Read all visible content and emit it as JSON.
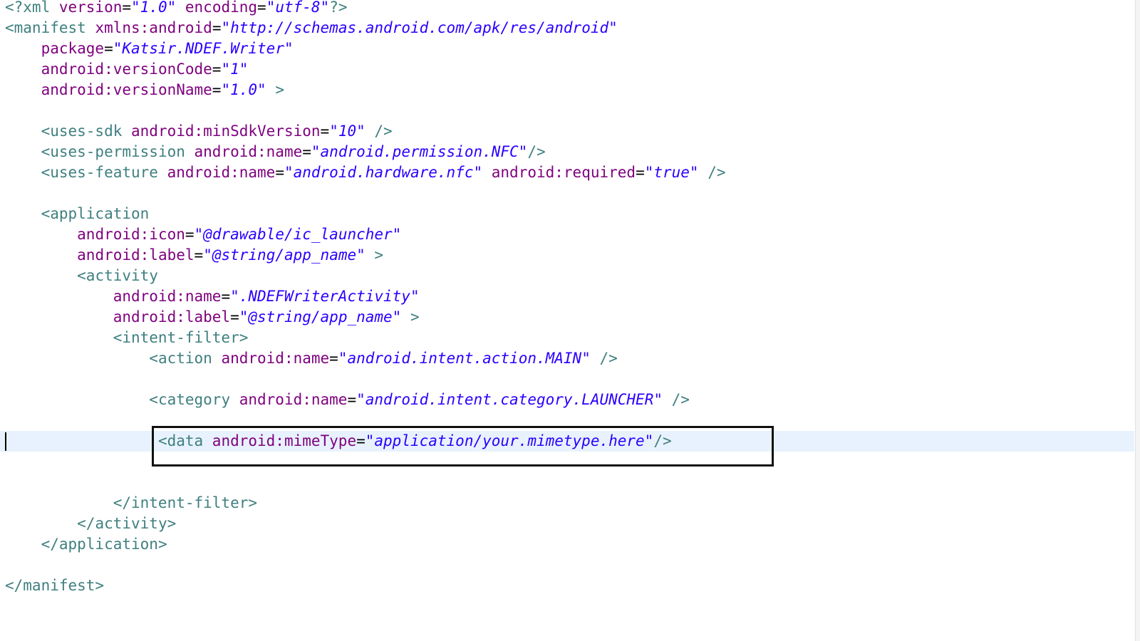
{
  "editor": {
    "lines": [
      [
        {
          "t": "<?xml ",
          "c": "tag"
        },
        {
          "t": "version",
          "c": "attr"
        },
        {
          "t": "=",
          "c": "eq"
        },
        {
          "t": "\"1.0\"",
          "c": "val"
        },
        {
          "t": " encoding",
          "c": "attr"
        },
        {
          "t": "=",
          "c": "eq"
        },
        {
          "t": "\"utf-8\"",
          "c": "val"
        },
        {
          "t": "?>",
          "c": "tag"
        }
      ],
      [
        {
          "t": "<manifest ",
          "c": "tag"
        },
        {
          "t": "xmlns:android",
          "c": "attr"
        },
        {
          "t": "=",
          "c": "eq"
        },
        {
          "t": "\"http://schemas.android.com/apk/res/android\"",
          "c": "val"
        }
      ],
      [
        {
          "t": "    "
        },
        {
          "t": "package",
          "c": "attr"
        },
        {
          "t": "=",
          "c": "eq"
        },
        {
          "t": "\"Katsir.NDEF.Writer\"",
          "c": "val"
        }
      ],
      [
        {
          "t": "    "
        },
        {
          "t": "android:versionCode",
          "c": "attr"
        },
        {
          "t": "=",
          "c": "eq"
        },
        {
          "t": "\"1\"",
          "c": "val"
        }
      ],
      [
        {
          "t": "    "
        },
        {
          "t": "android:versionName",
          "c": "attr"
        },
        {
          "t": "=",
          "c": "eq"
        },
        {
          "t": "\"1.0\"",
          "c": "val"
        },
        {
          "t": " >",
          "c": "tag"
        }
      ],
      [],
      [
        {
          "t": "    "
        },
        {
          "t": "<uses-sdk ",
          "c": "tag"
        },
        {
          "t": "android:minSdkVersion",
          "c": "attr"
        },
        {
          "t": "=",
          "c": "eq"
        },
        {
          "t": "\"10\"",
          "c": "val"
        },
        {
          "t": " />",
          "c": "tag"
        }
      ],
      [
        {
          "t": "    "
        },
        {
          "t": "<uses-permission ",
          "c": "tag"
        },
        {
          "t": "android:name",
          "c": "attr"
        },
        {
          "t": "=",
          "c": "eq"
        },
        {
          "t": "\"android.permission.NFC\"",
          "c": "val"
        },
        {
          "t": "/>",
          "c": "tag"
        }
      ],
      [
        {
          "t": "    "
        },
        {
          "t": "<uses-feature ",
          "c": "tag"
        },
        {
          "t": "android:name",
          "c": "attr"
        },
        {
          "t": "=",
          "c": "eq"
        },
        {
          "t": "\"android.hardware.nfc\"",
          "c": "val"
        },
        {
          "t": " android:required",
          "c": "attr"
        },
        {
          "t": "=",
          "c": "eq"
        },
        {
          "t": "\"true\"",
          "c": "val"
        },
        {
          "t": " />",
          "c": "tag"
        }
      ],
      [],
      [
        {
          "t": "    "
        },
        {
          "t": "<application",
          "c": "tag"
        }
      ],
      [
        {
          "t": "        "
        },
        {
          "t": "android:icon",
          "c": "attr"
        },
        {
          "t": "=",
          "c": "eq"
        },
        {
          "t": "\"@drawable/ic_launcher\"",
          "c": "val"
        }
      ],
      [
        {
          "t": "        "
        },
        {
          "t": "android:label",
          "c": "attr"
        },
        {
          "t": "=",
          "c": "eq"
        },
        {
          "t": "\"@string/app_name\"",
          "c": "val"
        },
        {
          "t": " >",
          "c": "tag"
        }
      ],
      [
        {
          "t": "        "
        },
        {
          "t": "<activity",
          "c": "tag"
        }
      ],
      [
        {
          "t": "            "
        },
        {
          "t": "android:name",
          "c": "attr"
        },
        {
          "t": "=",
          "c": "eq"
        },
        {
          "t": "\".NDEFWriterActivity\"",
          "c": "val"
        }
      ],
      [
        {
          "t": "            "
        },
        {
          "t": "android:label",
          "c": "attr"
        },
        {
          "t": "=",
          "c": "eq"
        },
        {
          "t": "\"@string/app_name\"",
          "c": "val"
        },
        {
          "t": " >",
          "c": "tag"
        }
      ],
      [
        {
          "t": "            "
        },
        {
          "t": "<intent-filter>",
          "c": "tag"
        }
      ],
      [
        {
          "t": "                "
        },
        {
          "t": "<action ",
          "c": "tag"
        },
        {
          "t": "android:name",
          "c": "attr"
        },
        {
          "t": "=",
          "c": "eq"
        },
        {
          "t": "\"android.intent.action.MAIN\"",
          "c": "val"
        },
        {
          "t": " />",
          "c": "tag"
        }
      ],
      [],
      [
        {
          "t": "                "
        },
        {
          "t": "<category ",
          "c": "tag"
        },
        {
          "t": "android:name",
          "c": "attr"
        },
        {
          "t": "=",
          "c": "eq"
        },
        {
          "t": "\"android.intent.category.LAUNCHER\"",
          "c": "val"
        },
        {
          "t": " />",
          "c": "tag"
        }
      ],
      [],
      [
        {
          "t": "                 "
        },
        {
          "t": "<data ",
          "c": "tag"
        },
        {
          "t": "android:mimeType",
          "c": "attr"
        },
        {
          "t": "=",
          "c": "eq"
        },
        {
          "t": "\"application/your.mimetype.here\"",
          "c": "val"
        },
        {
          "t": "/>",
          "c": "tag"
        }
      ],
      [],
      [],
      [
        {
          "t": "            "
        },
        {
          "t": "</intent-filter>",
          "c": "tag"
        }
      ],
      [
        {
          "t": "        "
        },
        {
          "t": "</activity>",
          "c": "tag"
        }
      ],
      [
        {
          "t": "    "
        },
        {
          "t": "</application>",
          "c": "tag"
        }
      ],
      [],
      [
        {
          "t": "</manifest>",
          "c": "tag"
        }
      ]
    ],
    "current_line": 21,
    "highlighted_line": 21
  },
  "colors": {
    "tag": "#3f7f7f",
    "attribute": "#7f007f",
    "string_value": "#2a00ff",
    "current_line_background": "#e8f2fe",
    "annotation_box_border": "#111111"
  }
}
